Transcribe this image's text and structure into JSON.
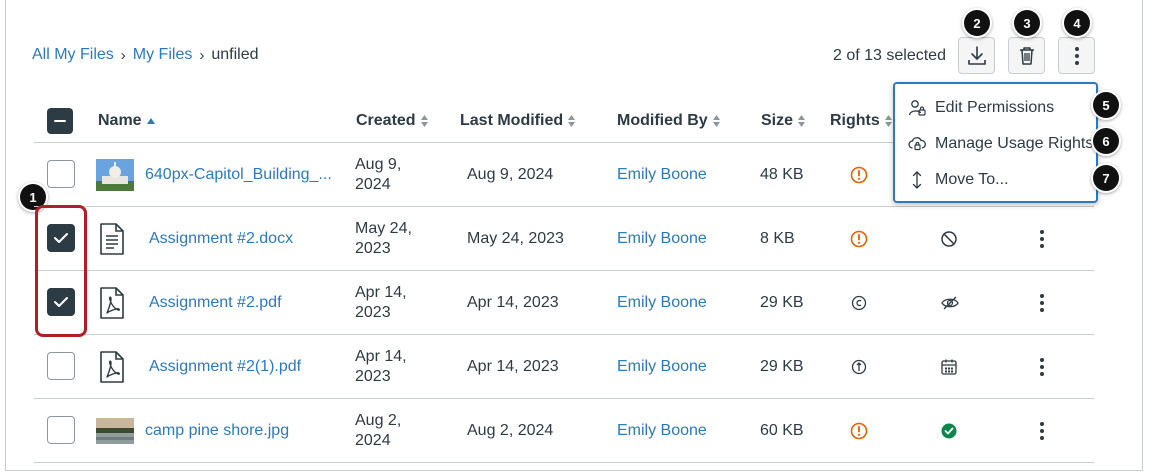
{
  "breadcrumb": {
    "items": [
      "All My Files",
      "My Files"
    ],
    "current": "unfiled",
    "separator": "›"
  },
  "toolbar": {
    "selection_text": "2 of 13 selected",
    "download_icon": "download-icon",
    "delete_icon": "trash-icon",
    "more_icon": "kebab-icon"
  },
  "callouts": [
    "1",
    "2",
    "3",
    "4",
    "5",
    "6",
    "7"
  ],
  "table": {
    "headers": {
      "name": "Name",
      "created": "Created",
      "last_modified": "Last Modified",
      "modified_by": "Modified By",
      "size": "Size",
      "rights": "Rights"
    },
    "rows": [
      {
        "name": "640px-Capitol_Building_...",
        "created": "Aug 9, 2024",
        "last_modified": "Aug 9, 2024",
        "modified_by": "Emily Boone",
        "size": "48 KB",
        "thumb": "capitol-image",
        "rights_icon": "warning-icon",
        "checked": false
      },
      {
        "name": "Assignment #2.docx",
        "created": "May 24, 2023",
        "last_modified": "May 24, 2023",
        "modified_by": "Emily Boone",
        "size": "8 KB",
        "thumb": "document-icon",
        "rights_icon": "warning-icon",
        "status_icon": "unpublished-icon",
        "checked": true
      },
      {
        "name": "Assignment #2.pdf",
        "created": "Apr 14, 2023",
        "last_modified": "Apr 14, 2023",
        "modified_by": "Emily Boone",
        "size": "29 KB",
        "thumb": "pdf-icon",
        "rights_icon": "copyright-icon",
        "status_icon": "hidden-icon",
        "checked": true
      },
      {
        "name": "Assignment #2(1).pdf",
        "created": "Apr 14, 2023",
        "last_modified": "Apr 14, 2023",
        "modified_by": "Emily Boone",
        "size": "29 KB",
        "thumb": "pdf-icon",
        "rights_icon": "public-domain-icon",
        "status_icon": "calendar-icon",
        "checked": false
      },
      {
        "name": "camp pine shore.jpg",
        "created": "Aug 2, 2024",
        "last_modified": "Aug 2, 2024",
        "modified_by": "Emily Boone",
        "size": "60 KB",
        "thumb": "lake-image",
        "rights_icon": "warning-icon",
        "status_icon": "published-icon",
        "checked": false
      }
    ]
  },
  "menu": {
    "items": [
      {
        "label": "Edit Permissions",
        "icon": "permissions-icon"
      },
      {
        "label": "Manage Usage Rights",
        "icon": "cloud-lock-icon"
      },
      {
        "label": "Move To...",
        "icon": "move-icon"
      }
    ]
  },
  "colors": {
    "link": "#2b7abc",
    "text": "#2d3b45",
    "warning": "#e66000",
    "success": "#0b874b",
    "highlight": "#b01f24",
    "menu_border": "#2b7abc"
  }
}
